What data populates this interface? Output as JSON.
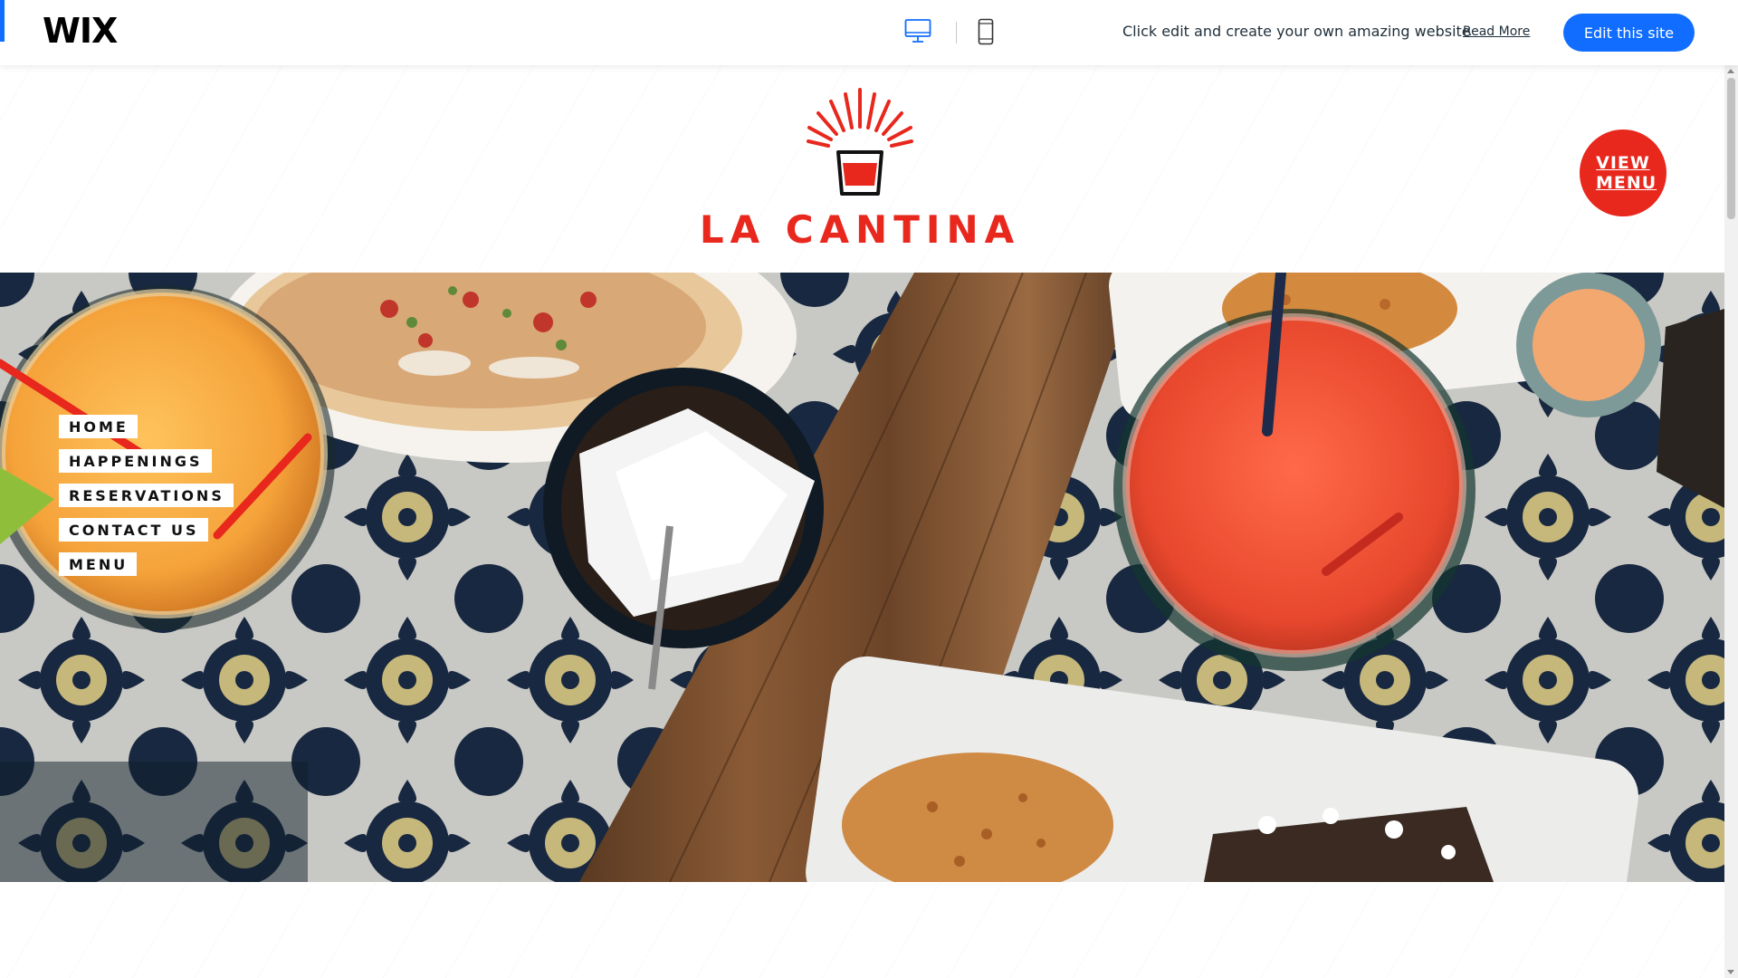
{
  "wix_bar": {
    "logo": "WIX",
    "promo_text": "Click edit and create your own amazing website",
    "read_more": "Read More",
    "edit_button": "Edit this site",
    "accent_color": "#116dff"
  },
  "site": {
    "brand_name": "LA CANTINA",
    "brand_color": "#e8271d",
    "view_menu_button": "VIEW MENU",
    "nav": [
      {
        "label": "HOME"
      },
      {
        "label": "HAPPENINGS"
      },
      {
        "label": "RESERVATIONS"
      },
      {
        "label": "CONTACT US"
      },
      {
        "label": "MENU"
      }
    ]
  },
  "icons": {
    "desktop": "desktop-icon",
    "mobile": "mobile-icon",
    "logo_mark": "drink-glass-icon"
  }
}
